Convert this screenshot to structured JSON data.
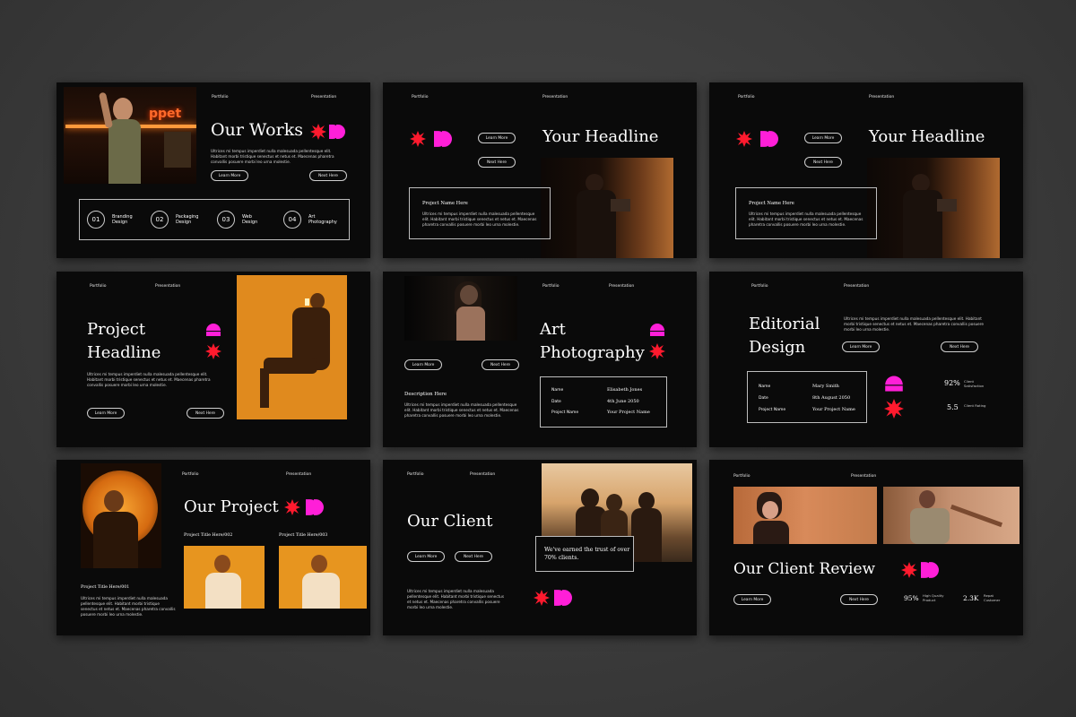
{
  "colors": {
    "accent_red": "#ff1a2e",
    "accent_magenta": "#ff1fd8",
    "slide_bg": "#0a0a0a",
    "orange": "#f2a52a"
  },
  "nav": {
    "portfolio": "Portfolio",
    "presentation": "Presentation"
  },
  "buttons": {
    "learn_more": "Learn More",
    "next_here": "Next Here"
  },
  "lorem": "Ultrices mi tempus imperdiet nulla malesuada pellentesque elit. Habitant morbi tristique senectus et netus et. Maecenas pharetra convallis posuere morbi leo urna molestie.",
  "slide1": {
    "title": "Our Works",
    "sign": "ppet",
    "services": [
      {
        "num": "01",
        "name": "Branding Design"
      },
      {
        "num": "02",
        "name": "Packaging Design"
      },
      {
        "num": "03",
        "name": "Web Design"
      },
      {
        "num": "04",
        "name": "Art Photography"
      }
    ]
  },
  "slide2": {
    "title": "Your Headline",
    "project_label": "Project Name Here"
  },
  "slide3": {
    "title": "Your Headline",
    "project_label": "Project Name Here"
  },
  "slide4": {
    "title_line1": "Project",
    "title_line2": "Headline"
  },
  "slide5": {
    "title_line1": "Art",
    "title_line2": "Photography",
    "desc_label": "Description Here",
    "details": [
      {
        "k": "Name",
        "v": "Elisabeth Jones"
      },
      {
        "k": "Date",
        "v": "4th June 2050"
      },
      {
        "k": "Project Name",
        "v": "Your Project Name"
      }
    ]
  },
  "slide6": {
    "title_line1": "Editorial",
    "title_line2": "Design",
    "details": [
      {
        "k": "Name",
        "v": "Mary Smith"
      },
      {
        "k": "Date",
        "v": "8th August 2050"
      },
      {
        "k": "Project Name",
        "v": "Your Project Name"
      }
    ],
    "stats": [
      {
        "value": "92%",
        "label": "Client Satisfaction"
      },
      {
        "value": "5.5",
        "label": "Client Rating"
      }
    ]
  },
  "slide7": {
    "title": "Our Project",
    "caption1": "Project Title Here/001",
    "caption2": "Project Title Here/002",
    "caption3": "Project Title Here/003"
  },
  "slide8": {
    "title": "Our Client",
    "quote": "We've earned the trust of over 70% clients."
  },
  "slide9": {
    "title": "Our Client Review",
    "stats": [
      {
        "value": "95%",
        "label": "High Quality Product"
      },
      {
        "value": "2.3K",
        "label": "Repat Customer"
      }
    ]
  }
}
